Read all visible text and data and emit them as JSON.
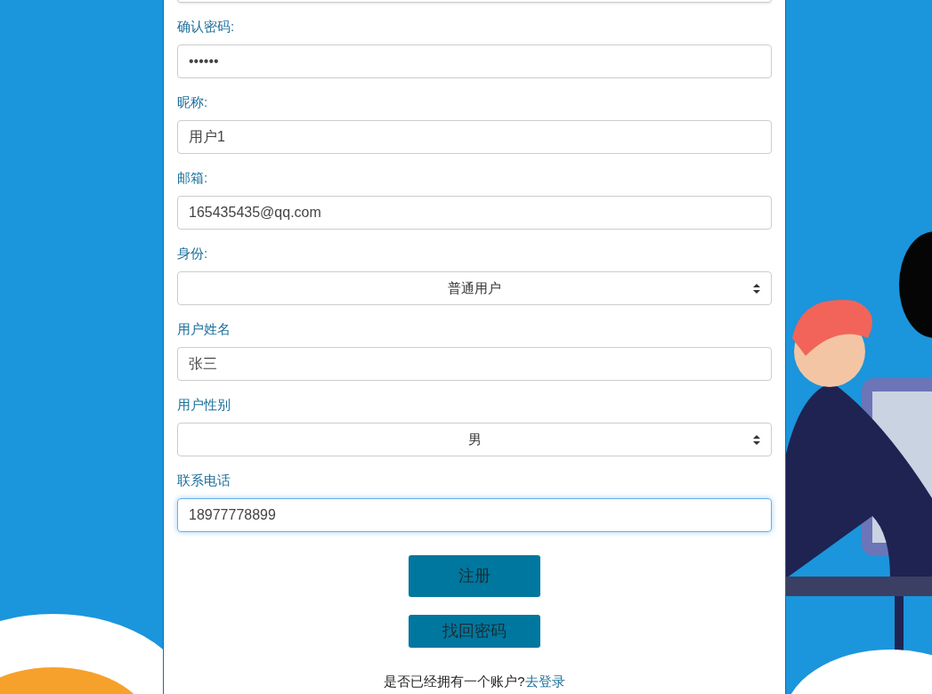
{
  "fields": [
    {
      "kind": "text",
      "label": "确认密码:",
      "value": "••••••",
      "focused": false
    },
    {
      "kind": "text",
      "label": "昵称:",
      "value": "用户1",
      "focused": false
    },
    {
      "kind": "text",
      "label": "邮箱:",
      "value": "165435435@qq.com",
      "focused": false
    },
    {
      "kind": "select",
      "label": "身份:",
      "value": "普通用户",
      "focused": false
    },
    {
      "kind": "text",
      "label": "用户姓名",
      "value": "张三",
      "focused": false
    },
    {
      "kind": "select",
      "label": "用户性别",
      "value": "男",
      "focused": false
    },
    {
      "kind": "text",
      "label": "联系电话",
      "value": "18977778899",
      "focused": true
    }
  ],
  "buttons": [
    {
      "label": "注册",
      "kind": "primary"
    },
    {
      "label": "找回密码",
      "kind": "secondary"
    }
  ],
  "footer": {
    "text": "是否已经拥有一个账户?",
    "link": "去登录"
  }
}
